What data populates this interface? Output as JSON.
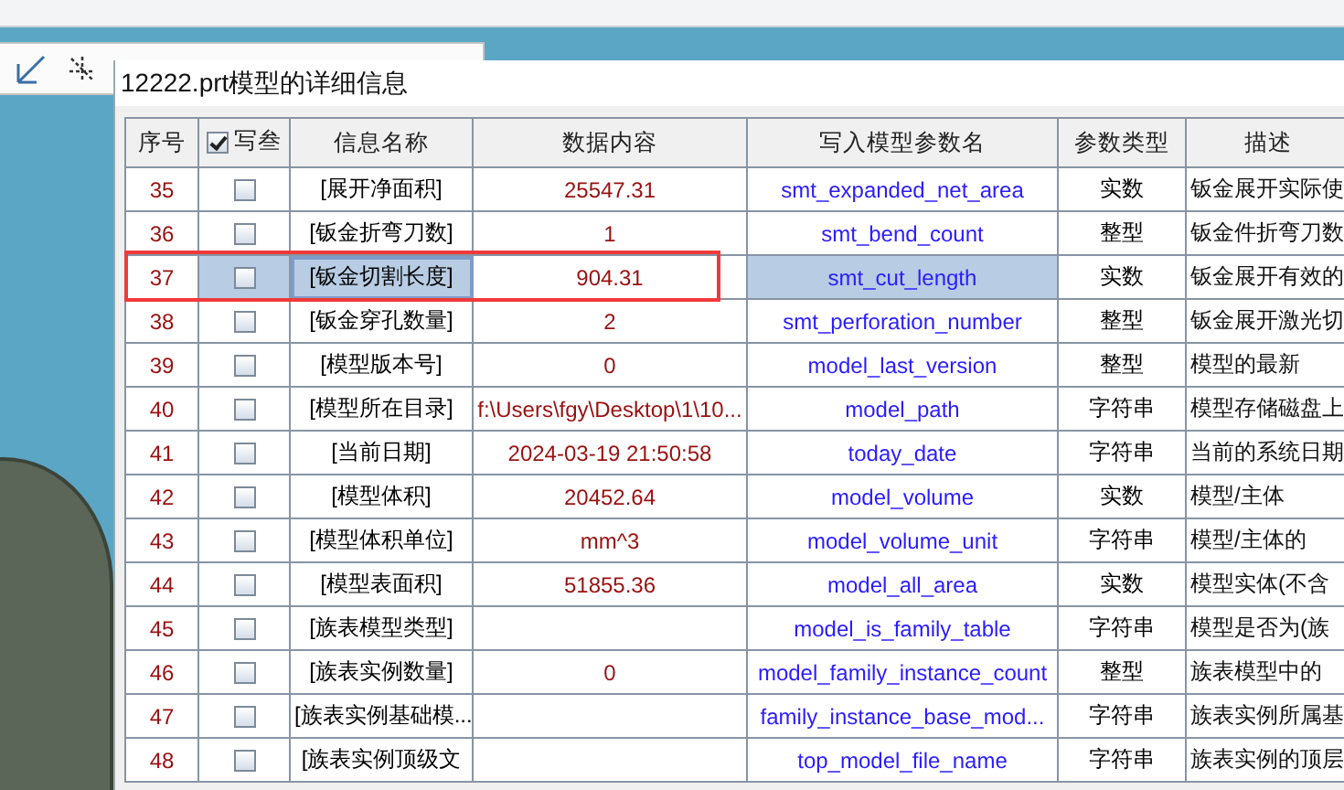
{
  "dialog": {
    "title": "12222.prt模型的详细信息"
  },
  "table": {
    "columns": [
      {
        "label": "序号"
      },
      {
        "label": "写叁",
        "kind": "checkbox",
        "checked": true
      },
      {
        "label": "信息名称"
      },
      {
        "label": "数据内容"
      },
      {
        "label": "写入模型参数名"
      },
      {
        "label": "参数类型"
      },
      {
        "label": "描述"
      }
    ],
    "rows": [
      {
        "number": "35",
        "checked": false,
        "name": "[展开净面积]",
        "value": "25547.31",
        "param": "smt_expanded_net_area",
        "type": "实数",
        "description": "钣金展开实际使",
        "selected": false,
        "framed": false
      },
      {
        "number": "36",
        "checked": false,
        "name": "[钣金折弯刀数]",
        "value": "1",
        "param": "smt_bend_count",
        "type": "整型",
        "description": "钣金件折弯刀数",
        "selected": false,
        "framed": false
      },
      {
        "number": "37",
        "checked": false,
        "name": "[钣金切割长度]",
        "value": "904.31",
        "param": "smt_cut_length",
        "type": "实数",
        "description": "钣金展开有效的",
        "selected": true,
        "framed": true
      },
      {
        "number": "38",
        "checked": false,
        "name": "[钣金穿孔数量]",
        "value": "2",
        "param": "smt_perforation_number",
        "type": "整型",
        "description": "钣金展开激光切",
        "selected": false,
        "framed": false
      },
      {
        "number": "39",
        "checked": false,
        "name": "[模型版本号]",
        "value": "0",
        "param": "model_last_version",
        "type": "整型",
        "description": "模型的最新",
        "selected": false,
        "framed": false
      },
      {
        "number": "40",
        "checked": false,
        "name": "[模型所在目录]",
        "value": "f:\\Users\\fgy\\Desktop\\1\\10...",
        "param": "model_path",
        "type": "字符串",
        "description": "模型存储磁盘上",
        "selected": false,
        "framed": false
      },
      {
        "number": "41",
        "checked": false,
        "name": "[当前日期]",
        "value": "2024-03-19 21:50:58",
        "param": "today_date",
        "type": "字符串",
        "description": "当前的系统日期",
        "selected": false,
        "framed": false
      },
      {
        "number": "42",
        "checked": false,
        "name": "[模型体积]",
        "value": "20452.64",
        "param": "model_volume",
        "type": "实数",
        "description": "模型/主体",
        "selected": false,
        "framed": false
      },
      {
        "number": "43",
        "checked": false,
        "name": "[模型体积单位]",
        "value": "mm^3",
        "param": "model_volume_unit",
        "type": "字符串",
        "description": "模型/主体的",
        "selected": false,
        "framed": false
      },
      {
        "number": "44",
        "checked": false,
        "name": "[模型表面积]",
        "value": "51855.36",
        "param": "model_all_area",
        "type": "实数",
        "description": "模型实体(不含",
        "selected": false,
        "framed": false
      },
      {
        "number": "45",
        "checked": false,
        "name": "[族表模型类型]",
        "param": "model_is_family_table",
        "type": "字符串",
        "description": "模型是否为(族",
        "selected": false,
        "framed": false
      },
      {
        "number": "46",
        "checked": false,
        "name": "[族表实例数量]",
        "value": "0",
        "param": "model_family_instance_count",
        "type": "整型",
        "description": "族表模型中的",
        "selected": false,
        "framed": false
      },
      {
        "number": "47",
        "checked": false,
        "name": "[族表实例基础模...",
        "param": "family_instance_base_mod...",
        "type": "字符串",
        "description": "族表实例所属基",
        "selected": false,
        "framed": false
      },
      {
        "number": "48",
        "checked": false,
        "name": "[族表实例顶级文",
        "param": "top_model_file_name",
        "type": "字符串",
        "description": "族表实例的顶层",
        "selected": false,
        "framed": false
      }
    ]
  }
}
